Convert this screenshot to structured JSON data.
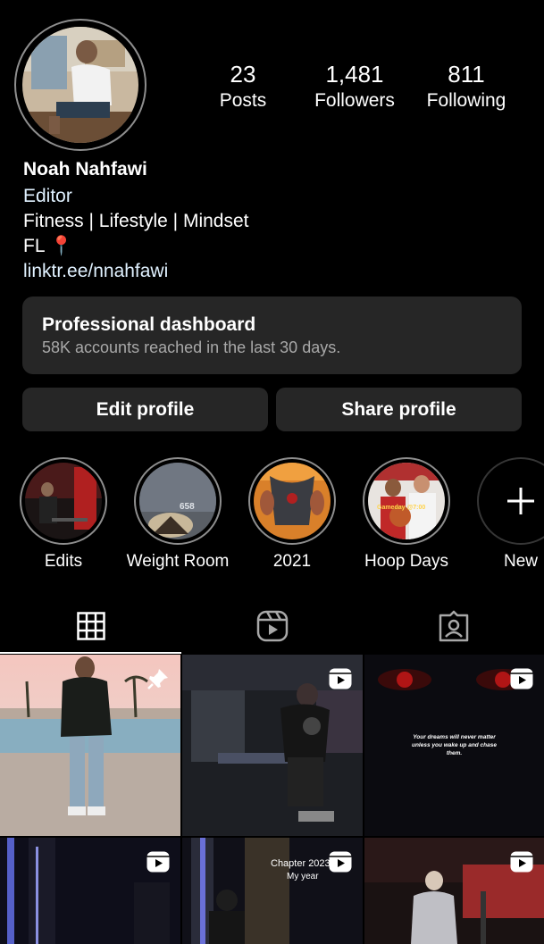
{
  "profile": {
    "name": "Noah Nahfawi",
    "category": "Editor",
    "bio_line_1": "Fitness | Lifestyle | Mindset",
    "bio_line_2": "FL 📍",
    "link": "linktr.ee/nnahfawi"
  },
  "stats": [
    {
      "value": "23",
      "label": "Posts"
    },
    {
      "value": "1,481",
      "label": "Followers"
    },
    {
      "value": "811",
      "label": "Following"
    }
  ],
  "dashboard": {
    "title": "Professional dashboard",
    "subtitle": "58K accounts reached in the last 30 days."
  },
  "buttons": {
    "edit": "Edit profile",
    "share": "Share profile"
  },
  "highlights": [
    {
      "label": "Edits"
    },
    {
      "label": "Weight Room"
    },
    {
      "label": "2021"
    },
    {
      "label": "Hoop Days"
    },
    {
      "label": "New"
    }
  ],
  "highlight_thumb_text": {
    "weight_room": "658",
    "hoop_days": "Gameday @7:00"
  },
  "tabs": [
    {
      "icon": "grid-icon",
      "active": true
    },
    {
      "icon": "reels-icon",
      "active": false
    },
    {
      "icon": "tagged-icon",
      "active": false
    }
  ],
  "posts": {
    "quote": "Your dreams will never matter unless you wake up and chase them.",
    "chapter_title": "Chapter 2023",
    "chapter_sub": "My year"
  }
}
